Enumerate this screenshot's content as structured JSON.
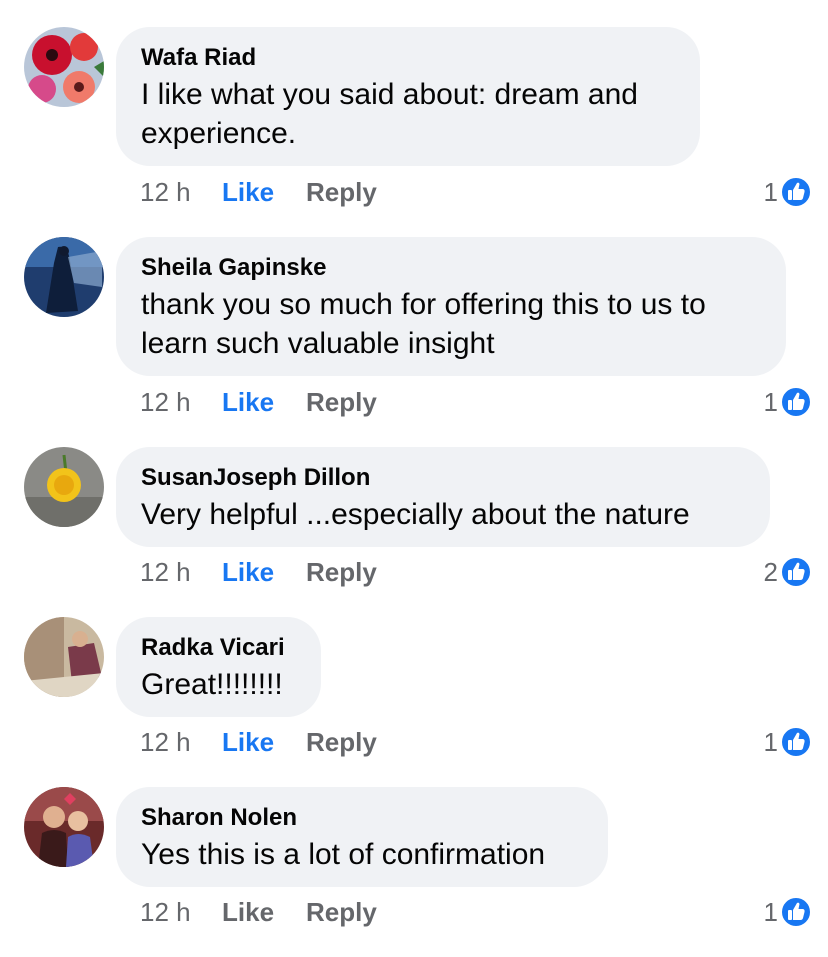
{
  "icons": {
    "reaction": "thumbs-up-icon"
  },
  "colors": {
    "like_active": "#1877f2",
    "bubble": "#f0f2f5",
    "meta": "#65676b"
  },
  "comments": [
    {
      "author": "Wafa Riad",
      "line1": "I like what you said about: dream and",
      "line2": "experience.",
      "time": "12 h",
      "like_label": "Like",
      "reply_label": "Reply",
      "reactions": "1",
      "liked": true
    },
    {
      "author": "Sheila Gapinske",
      "line1": "thank you so much for offering this to us to",
      "line2": "learn such valuable insight",
      "time": "12 h",
      "like_label": "Like",
      "reply_label": "Reply",
      "reactions": "1",
      "liked": true
    },
    {
      "author": "SusanJoseph Dillon",
      "line1": "Very helpful ...especially  about the nature",
      "time": "12 h",
      "like_label": "Like",
      "reply_label": "Reply",
      "reactions": "2",
      "liked": true
    },
    {
      "author": "Radka Vicari",
      "line1": "Great!!!!!!!!",
      "time": "12 h",
      "like_label": "Like",
      "reply_label": "Reply",
      "reactions": "1",
      "liked": true
    },
    {
      "author": "Sharon Nolen",
      "line1": "Yes this is a lot of confirmation",
      "time": "12 h",
      "like_label": "Like",
      "reply_label": "Reply",
      "reactions": "1",
      "liked": false
    }
  ]
}
